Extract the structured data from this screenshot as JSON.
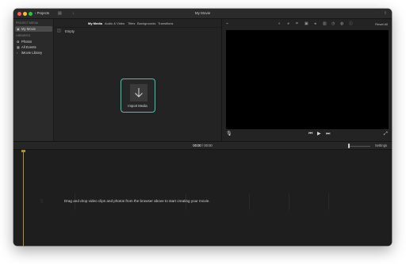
{
  "window": {
    "title": "My Movie",
    "projects_label": "Projects"
  },
  "sidebar": {
    "project_media_header": "PROJECT MEDIA",
    "project_item": "My Movie",
    "libraries_header": "LIBRARIES",
    "items": [
      {
        "label": "Photos",
        "icon": "photos-icon"
      },
      {
        "label": "All Events",
        "icon": "events-icon"
      },
      {
        "label": "iMovie Library",
        "icon": "library-icon"
      }
    ]
  },
  "browser": {
    "tabs": [
      "My Media",
      "Audio & Video",
      "Titles",
      "Backgrounds",
      "Transitions"
    ],
    "active_tab": "My Media",
    "empty_label": "Empty",
    "import_label": "Import Media"
  },
  "viewer": {
    "reset_all": "Reset All"
  },
  "timeline": {
    "current_time": "00:00",
    "separator": "/",
    "total_time": "00:00",
    "settings_label": "Settings",
    "drop_hint": "Drag and drop video clips and photos from the browser above to start creating your movie."
  },
  "colors": {
    "accent": "#3cc7a6",
    "playhead": "#b58f22"
  }
}
